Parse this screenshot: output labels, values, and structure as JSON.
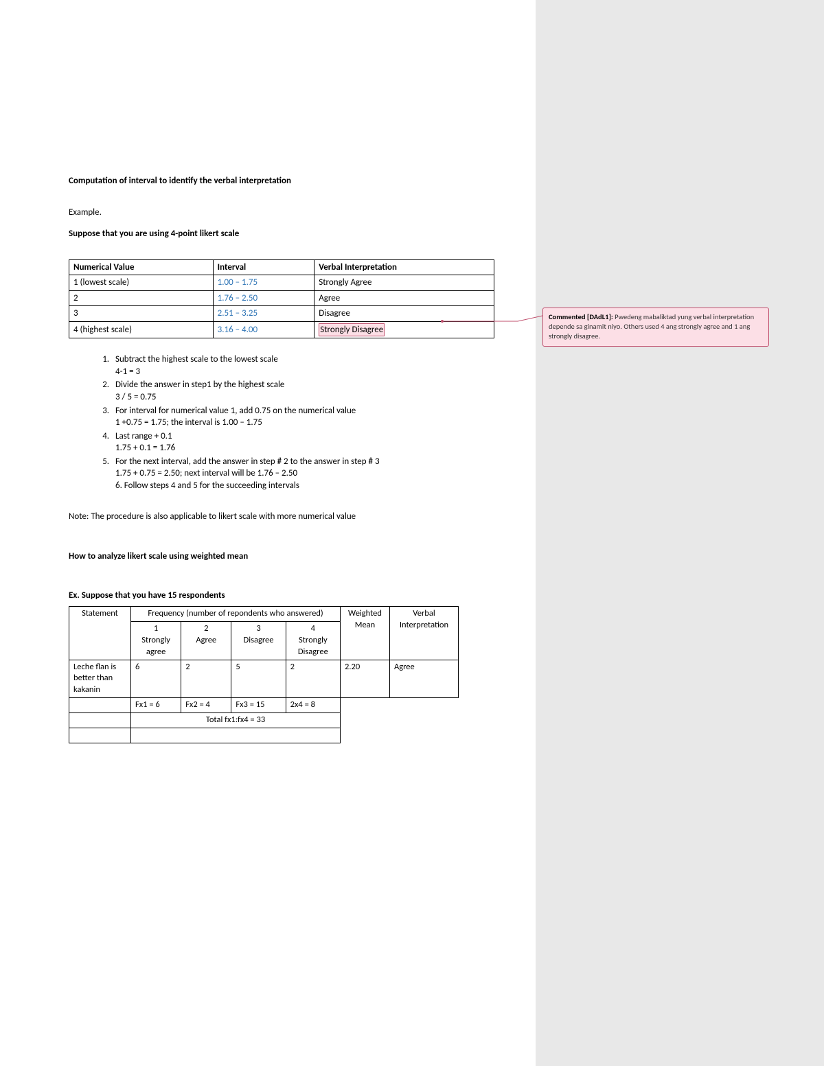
{
  "title": "Computation of interval to identify the verbal interpretation",
  "example_label": "Example.",
  "suppose": "Suppose that you are using 4-point likert scale",
  "table1": {
    "headers": [
      "Numerical Value",
      "Interval",
      "Verbal Interpretation"
    ],
    "rows": [
      {
        "nv": "1 (lowest scale)",
        "interval": "1.00 – 1.75",
        "vi": "Strongly Agree",
        "hl": false
      },
      {
        "nv": "2",
        "interval": "1.76 – 2.50",
        "vi": "Agree",
        "hl": false
      },
      {
        "nv": "3",
        "interval": "2.51 – 3.25",
        "vi": "Disagree",
        "hl": false
      },
      {
        "nv": "4 (highest scale)",
        "interval": "3.16 – 4.00",
        "vi": "Strongly Disagree",
        "hl": true
      }
    ]
  },
  "steps": [
    "Subtract the highest scale to the lowest scale",
    "Divide the answer in step1 by the highest scale",
    "For interval for numerical value 1, add 0.75 on the numerical value",
    "Last range + 0.1",
    "For the next interval, add the answer in step # 2 to the answer in step # 3"
  ],
  "substeps": [
    "4-1 = 3",
    "3 / 5 = 0.75",
    "1 +0.75 = 1.75; the interval is 1.00 – 1.75",
    "1.75 + 0.1 = 1.76",
    "1.75 + 0.75 = 2.50; next interval will be 1.76 – 2.50"
  ],
  "step6": "6. Follow steps 4 and 5 for the succeeding intervals",
  "note": "Note: The procedure is also applicable to likert scale with more numerical value",
  "heading2": "How to analyze likert scale using weighted mean",
  "ex2": "Ex. Suppose that you have 15 respondents",
  "table2": {
    "h_statement": "Statement",
    "h_freq": "Frequency (number of repondents who answered)",
    "h_wm": "Weighted Mean",
    "h_vi": "Verbal Interpretation",
    "sub": [
      {
        "n": "1",
        "l": "Strongly agree"
      },
      {
        "n": "2",
        "l": "Agree"
      },
      {
        "n": "3",
        "l": "Disagree"
      },
      {
        "n": "4",
        "l": "Strongly Disagree"
      }
    ],
    "row": {
      "stmt": "Leche flan is better than kakanin",
      "f": [
        "6",
        "2",
        "5",
        "2"
      ],
      "wm": "2.20",
      "vi": "Agree"
    },
    "fx": [
      "Fx1 = 6",
      "Fx2 = 4",
      "Fx3 = 15",
      "2x4 = 8"
    ],
    "total": "Total fx1:fx4 = 33"
  },
  "comment": {
    "lead": "Commented [DAdL1]: ",
    "body": "Pwedeng mabaliktad yung verbal interpretation depende sa ginamit niyo. Others used 4 ang strongly agree and 1 ang strongly disagree."
  }
}
